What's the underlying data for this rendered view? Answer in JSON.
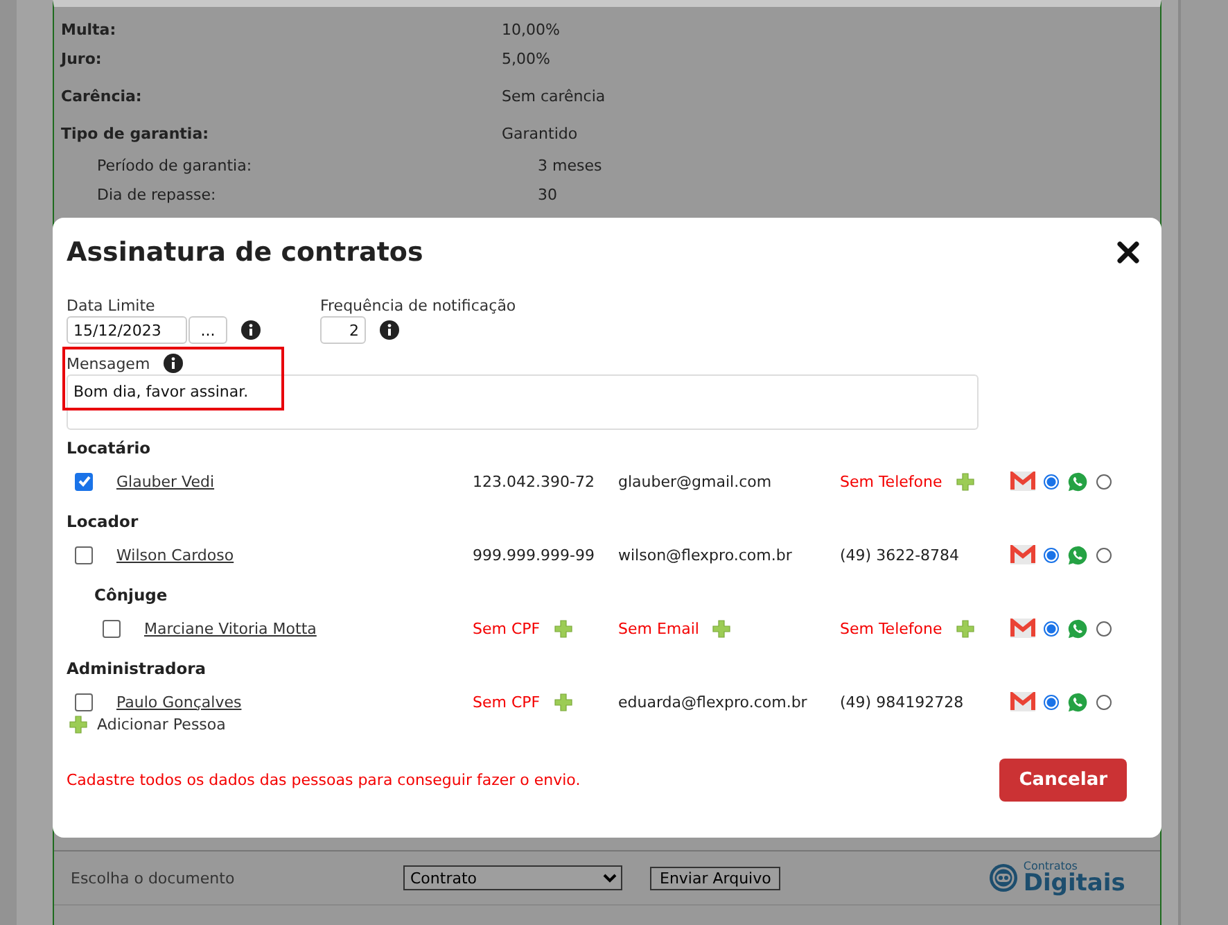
{
  "background": {
    "fields": [
      {
        "label": "Multa:",
        "value": "10,00%",
        "bold": true,
        "indented": false
      },
      {
        "label": "Juro:",
        "value": "5,00%",
        "bold": true,
        "indented": false
      },
      {
        "label": "Carência:",
        "value": "Sem carência",
        "bold": true,
        "indented": false
      },
      {
        "label": "Tipo de garantia:",
        "value": "Garantido",
        "bold": true,
        "indented": false
      },
      {
        "label": "Período de garantia:",
        "value": "3 meses",
        "bold": false,
        "indented": true
      },
      {
        "label": "Dia de repasse:",
        "value": "30",
        "bold": false,
        "indented": true
      }
    ],
    "document_label": "Escolha o documento",
    "document_select": "Contrato",
    "send_button": "Enviar Arquivo",
    "logo": {
      "small": "Contratos",
      "big": "Digitais"
    }
  },
  "modal": {
    "title": "Assinatura de contratos",
    "date_label": "Data Limite",
    "date_value": "15/12/2023",
    "date_button": "...",
    "frequency_label": "Frequência de notificação",
    "frequency_value": "2",
    "message_label": "Mensagem",
    "message_value": "Bom dia, favor assinar.",
    "message_highlighted": true,
    "groups": [
      {
        "title": "Locatário",
        "indented": false,
        "people": [
          {
            "name": "Glauber Vedi",
            "checked": true,
            "cpf": {
              "text": "123.042.390-72",
              "missing": false
            },
            "email": {
              "text": "glauber@gmail.com",
              "missing": false
            },
            "phone": {
              "text": "Sem Telefone",
              "missing": true
            },
            "notify_email": true,
            "notify_whatsapp": false
          }
        ]
      },
      {
        "title": "Locador",
        "indented": false,
        "people": [
          {
            "name": "Wilson Cardoso",
            "checked": false,
            "cpf": {
              "text": "999.999.999-99",
              "missing": false
            },
            "email": {
              "text": "wilson@flexpro.com.br",
              "missing": false
            },
            "phone": {
              "text": "(49) 3622-8784",
              "missing": false
            },
            "notify_email": true,
            "notify_whatsapp": false
          }
        ]
      },
      {
        "title": "Cônjuge",
        "indented": true,
        "people": [
          {
            "name": "Marciane Vitoria Motta",
            "checked": false,
            "cpf": {
              "text": "Sem CPF",
              "missing": true
            },
            "email": {
              "text": "Sem Email",
              "missing": true
            },
            "phone": {
              "text": "Sem Telefone",
              "missing": true
            },
            "notify_email": true,
            "notify_whatsapp": false
          }
        ]
      },
      {
        "title": "Administradora",
        "indented": false,
        "people": [
          {
            "name": "Paulo Gonçalves",
            "checked": false,
            "cpf": {
              "text": "Sem CPF",
              "missing": true
            },
            "email": {
              "text": "eduarda@flexpro.com.br",
              "missing": false
            },
            "phone": {
              "text": "(49) 984192728",
              "missing": false
            },
            "notify_email": true,
            "notify_whatsapp": false
          }
        ]
      }
    ],
    "add_person": "Adicionar Pessoa",
    "warning": "Cadastre todos os dados das pessoas para conseguir fazer o envio.",
    "cancel_button": "Cancelar"
  }
}
